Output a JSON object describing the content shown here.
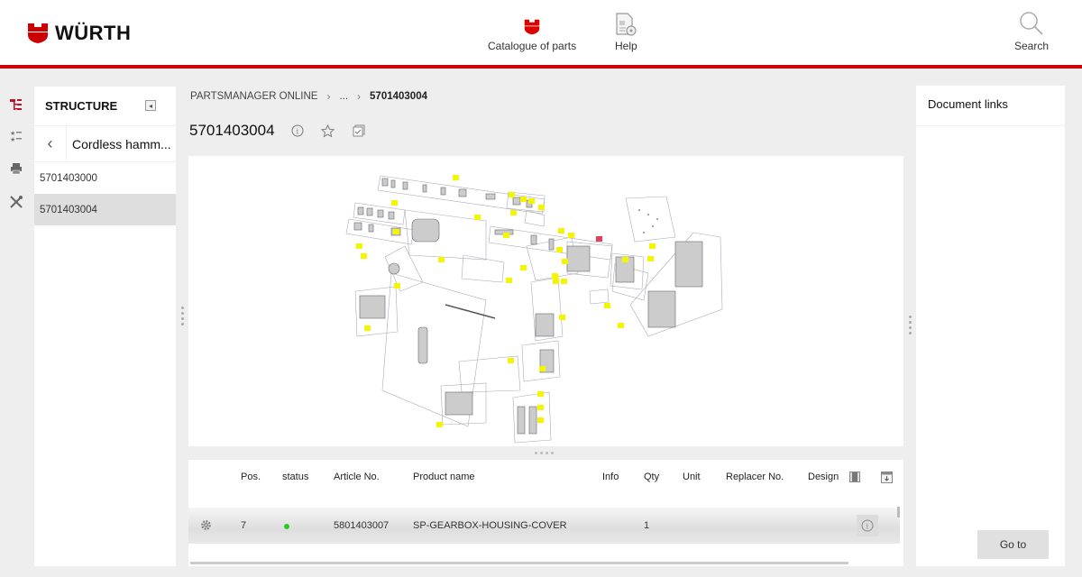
{
  "header": {
    "brand": "WÜRTH",
    "brand_color": "#cc0000",
    "nav": [
      {
        "label": "Catalogue of parts",
        "icon": "wurth-shield-icon"
      },
      {
        "label": "Help",
        "icon": "help-document-icon"
      },
      {
        "label": "Search",
        "icon": "search-icon"
      }
    ]
  },
  "left_rail": {
    "icons": [
      "structure-tree-icon",
      "favorites-list-icon",
      "print-icon",
      "tools-icon"
    ]
  },
  "structure": {
    "title": "STRUCTURE",
    "back_label": "Cordless hamm...",
    "items": [
      {
        "label": "5701403000",
        "active": false
      },
      {
        "label": "5701403004",
        "active": true
      }
    ]
  },
  "breadcrumb": {
    "items": [
      "PARTSMANAGER ONLINE",
      "...",
      "5701403004"
    ],
    "separator": "›"
  },
  "page": {
    "title": "5701403004"
  },
  "drawing": {
    "description": "Exploded view diagram of cordless hammer drill 5701403004 with yellow position callouts"
  },
  "parts_table": {
    "columns": [
      "",
      "Pos.",
      "status",
      "Article No.",
      "Product name",
      "Info",
      "Qty",
      "Unit",
      "Replacer No.",
      "Design"
    ],
    "rows": [
      {
        "pos": "7",
        "status": "available",
        "status_color": "#22cc22",
        "article_no": "5801403007",
        "product_name": "SP-GEARBOX-HOUSING-COVER",
        "info": "",
        "qty": "1",
        "unit": "",
        "replacer_no": "",
        "design": ""
      }
    ]
  },
  "document_links": {
    "title": "Document links",
    "goto_label": "Go to"
  }
}
